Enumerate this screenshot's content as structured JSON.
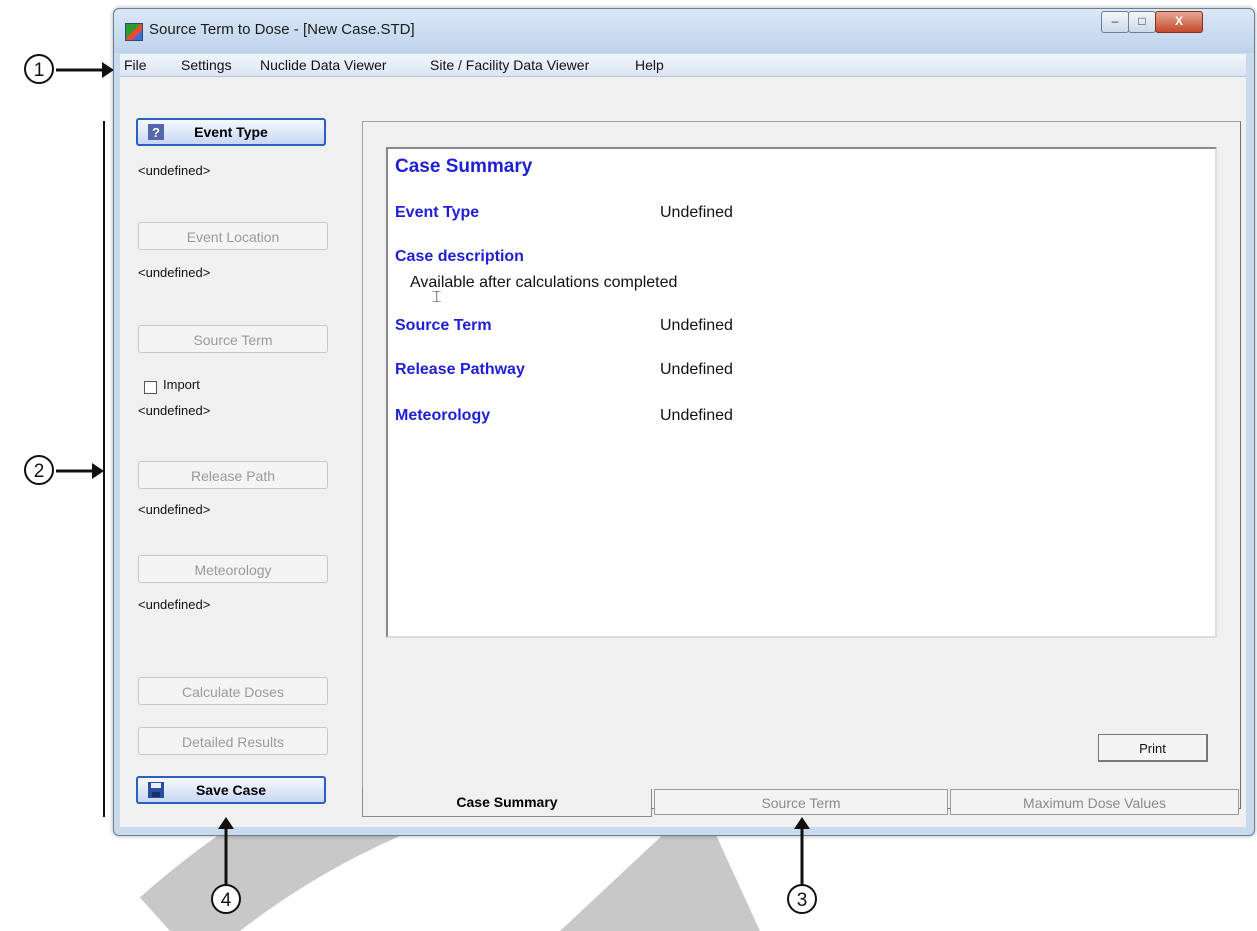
{
  "window": {
    "title": "Source Term to Dose - [New Case.STD]",
    "controls": {
      "minimize": "–",
      "maximize": "□",
      "close": "X"
    }
  },
  "menu": {
    "items": [
      "File",
      "Settings",
      "Nuclide Data Viewer",
      "Site / Facility Data Viewer",
      "Help"
    ]
  },
  "left_panel": {
    "event_type": {
      "label": "Event Type",
      "value": "<undefined>",
      "icon": "help-icon"
    },
    "event_location": {
      "label": "Event Location",
      "value": "<undefined>"
    },
    "source_term": {
      "label": "Source Term",
      "import_label": "Import",
      "import_checked": false,
      "value": "<undefined>"
    },
    "release_path": {
      "label": "Release Path",
      "value": "<undefined>"
    },
    "meteorology": {
      "label": "Meteorology",
      "value": "<undefined>"
    },
    "calculate_doses": {
      "label": "Calculate Doses"
    },
    "detailed_results": {
      "label": "Detailed Results"
    },
    "save_case": {
      "label": "Save Case",
      "icon": "floppy-disk-icon"
    }
  },
  "summary": {
    "title": "Case Summary",
    "event_type": {
      "label": "Event Type",
      "value": "Undefined"
    },
    "case_description": {
      "label": "Case description",
      "value": "Available after calculations completed"
    },
    "source_term": {
      "label": "Source Term",
      "value": "Undefined"
    },
    "release_pathway": {
      "label": "Release Pathway",
      "value": "Undefined"
    },
    "meteorology": {
      "label": "Meteorology",
      "value": "Undefined"
    },
    "print_label": "Print"
  },
  "tabs": [
    "Case Summary",
    "Source Term",
    "Maximum Dose Values"
  ],
  "callouts": [
    "1",
    "2",
    "3",
    "4"
  ],
  "colors": {
    "label_blue": "#1f1fd6",
    "active_border": "#2d5fbf"
  }
}
